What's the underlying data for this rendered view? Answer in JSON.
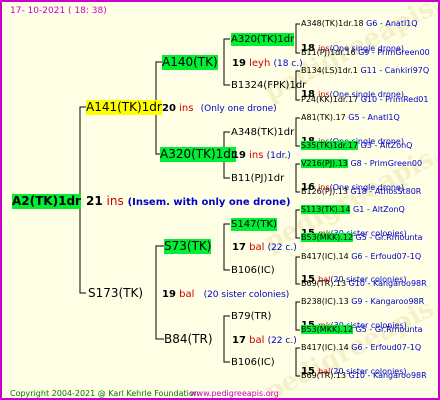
{
  "header": "17- 10-2021 ( 18: 38)",
  "footer": {
    "copyright": "Copyright 2004-2021 @ Karl Kehrle Foundation",
    "site": "www.pedigreeapis.org"
  },
  "watermark": "pedigreeapis.org",
  "root": {
    "label": "A2(TK)1dr",
    "count": "21",
    "unit": "ins",
    "desc": "(Insem. with only one drone)"
  },
  "gen1": [
    {
      "label": "A141(TK)1dr",
      "count": "20",
      "unit": "ins",
      "desc": "(Only one drone)"
    },
    {
      "label": "S173(TK)",
      "count": "19",
      "unit": "bal",
      "desc": "(20 sister colonies)"
    }
  ],
  "gen2": [
    {
      "label": "A140(TK)",
      "count": "19",
      "unit": "leyh",
      "desc": "(18 c.)"
    },
    {
      "label": "A320(TK)1dr",
      "count": "19",
      "unit": "ins",
      "desc": "(1dr.)"
    },
    {
      "label": "S73(TK)",
      "count": "17",
      "unit": "bal",
      "desc": "(22 c.)"
    },
    {
      "label": "B84(TR)",
      "count": "17",
      "unit": "bal",
      "desc": "(22 c.)"
    }
  ],
  "gen3": [
    {
      "label": "A320(TK)1dr",
      "count": "18",
      "unit": "ins",
      "desc": "(One single drone)"
    },
    {
      "label": "B1324(FPK)1dr",
      "count": "18",
      "unit": "ins",
      "desc": "(One single drone)"
    },
    {
      "label": "A348(TK)1dr",
      "count": "18",
      "unit": "ins",
      "desc": "(One single drone)"
    },
    {
      "label": "B11(PJ)1dr",
      "count": "16",
      "unit": "ins",
      "desc": "(One single drone)"
    },
    {
      "label": "S147(TK)",
      "count": "15",
      "unit": "mk",
      "desc": "(30 sister colonies)"
    },
    {
      "label": "B106(IC)",
      "count": "15",
      "unit": "bal",
      "desc": "(20 sister colonies)"
    },
    {
      "label": "B79(TR)",
      "count": "15",
      "unit": "mk",
      "desc": "(30 sister colonies)"
    },
    {
      "label": "B106(IC)",
      "count": "15",
      "unit": "bal",
      "desc": "(20 sister colonies)"
    }
  ],
  "gen4": [
    {
      "name": "A348(TK)1dr.18",
      "tag": "G6 - Anatl1Q"
    },
    {
      "name": "B11(PJ)1dr.16",
      "tag": "G9 - PrimGreen00"
    },
    {
      "name": "B134(LS)1dr.1",
      "tag": "G11 - Cankiri97Q"
    },
    {
      "name": "P24(KK)1dr.17",
      "tag": "G10 - PrimRed01"
    },
    {
      "name": "A81(TK).17",
      "tag": "G5 - Anatl1Q"
    },
    {
      "name": "S35(TK)1dr.17",
      "tag": "G3 - AltZonQ"
    },
    {
      "name": "V216(PJ).13",
      "tag": "G8 - PrimGreen00"
    },
    {
      "name": "B126(PJ).13",
      "tag": "G18 - AthosSt80R"
    },
    {
      "name": "S113(TK).14",
      "tag": "G1 - AltZonQ"
    },
    {
      "name": "B53(MKK).12",
      "tag": "G5 - Gr.Rmounta"
    },
    {
      "name": "B417(IC).14",
      "tag": "G6 - Erfoud07-1Q"
    },
    {
      "name": "B69(TR).13",
      "tag": "G10 - Kangaroo98R"
    },
    {
      "name": "B238(IC).13",
      "tag": "G9 - Kangaroo98R"
    },
    {
      "name": "B53(MKK).12",
      "tag": "G5 - Gr.Rmounta"
    },
    {
      "name": "B417(IC).14",
      "tag": "G6 - Erfoud07-1Q"
    },
    {
      "name": "B69(TR).13",
      "tag": "G10 - Kangaroo98R"
    }
  ]
}
